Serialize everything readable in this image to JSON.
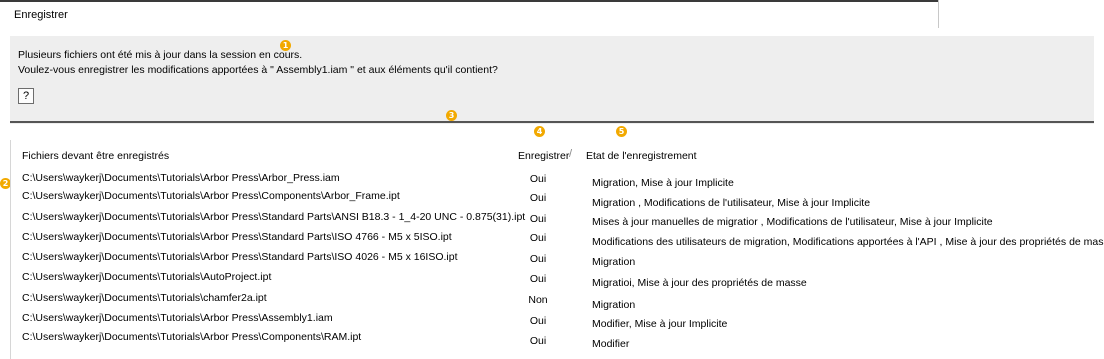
{
  "window": {
    "title": "Enregistrer"
  },
  "message": {
    "line1": "Plusieurs fichiers ont été mis à jour dans la session en cours.",
    "line2": "Voulez-vous enregistrer les modifications apportées à \" Assembly1.iam  \" et aux éléments qu'il contient?"
  },
  "help_glyph": "?",
  "badges": [
    "1",
    "2",
    "3",
    "4",
    "5"
  ],
  "accent_color": "#f2a900",
  "table": {
    "headers": {
      "files": "Fichiers devant être enregistrés",
      "save": "Enregistrer",
      "sort_glyph": "/",
      "status": "Etat de l'enregistrement"
    },
    "rows": [
      {
        "file": "C:\\Users\\waykerj\\Documents\\Tutorials\\Arbor Press\\Arbor_Press.iam",
        "save": "Oui",
        "status": "Migration, Mise à jour Implicite"
      },
      {
        "file": "C:\\Users\\waykerj\\Documents\\Tutorials\\Arbor Press\\Components\\Arbor_Frame.ipt",
        "save": "Oui",
        "status": "Migration , Modifications de l'utilisateur, Mise à jour Implicite"
      },
      {
        "file": "C:\\Users\\waykerj\\Documents\\Tutorials\\Arbor Press\\Standard Parts\\ANSI B18.3 - 1_4-20 UNC - 0.875(31).ipt",
        "save": "Oui",
        "status": "Mises à jour manuelles de migratior , Modifications de l'utilisateur, Mise à jour Implicite"
      },
      {
        "file": "C:\\Users\\waykerj\\Documents\\Tutorials\\Arbor Press\\Standard Parts\\ISO 4766 - M5 x 5ISO.ipt",
        "save": "Oui",
        "status": "Modifications des utilisateurs de migration, Modifications apportées à l'API , Mise à jour des propriétés de masse"
      },
      {
        "file": "C:\\Users\\waykerj\\Documents\\Tutorials\\Arbor Press\\Standard Parts\\ISO 4026 - M5 x 16ISO.ipt",
        "save": "Oui",
        "status": "Migration"
      },
      {
        "file": "C:\\Users\\waykerj\\Documents\\Tutorials\\AutoProject.ipt",
        "save": "Oui",
        "status": "Migratioi, Mise à jour des propriétés de masse"
      },
      {
        "file": "C:\\Users\\waykerj\\Documents\\Tutorials\\chamfer2a.ipt",
        "save": "Non",
        "status": "Migration"
      },
      {
        "file": "C:\\Users\\waykerj\\Documents\\Tutorials\\Arbor Press\\Assembly1.iam",
        "save": "Oui",
        "status": "Modifier, Mise à jour Implicite"
      },
      {
        "file": "C:\\Users\\waykerj\\Documents\\Tutorials\\Arbor Press\\Components\\RAM.ipt",
        "save": "Oui",
        "status": "Modifier"
      }
    ]
  }
}
